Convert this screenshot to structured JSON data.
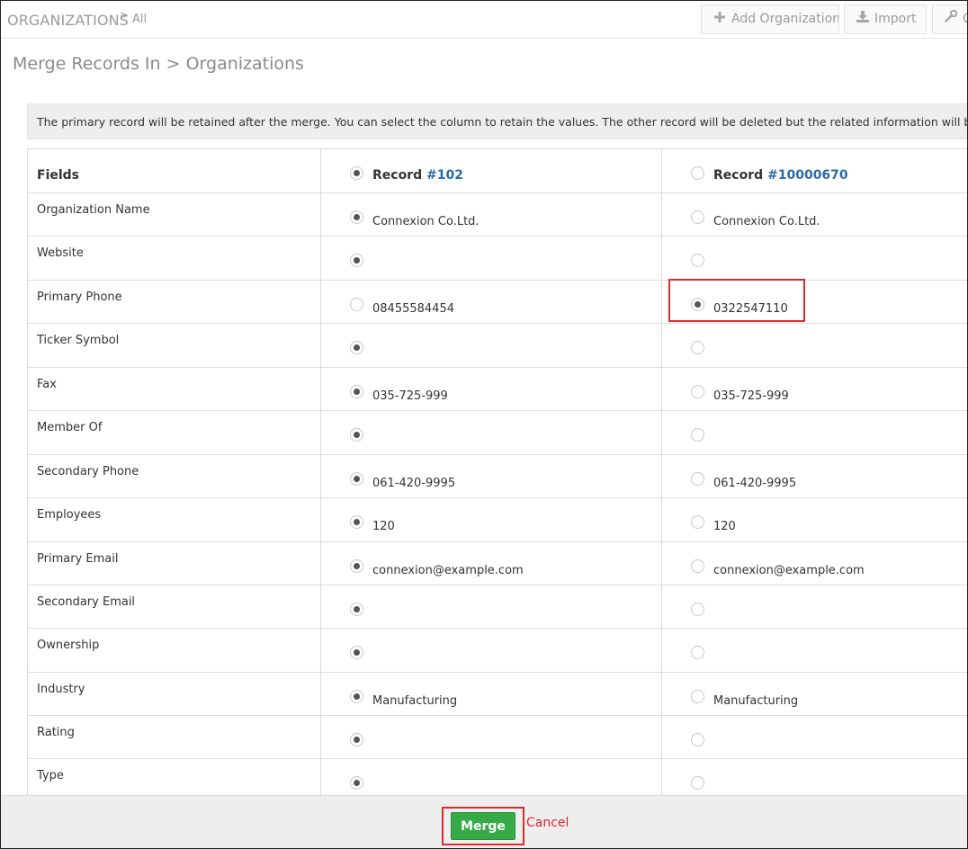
{
  "header": {
    "module": "ORGANIZATIONS",
    "breadcrumb_sep": ">",
    "breadcrumb_all": "All",
    "add_label": "Add Organization",
    "import_label": "Import",
    "more_label": "C"
  },
  "page_title": "Merge Records In > Organizations",
  "notice": "The primary record will be retained after the merge. You can select the column to retain the values. The other record will be deleted but the related information will be merged.",
  "table": {
    "fields_header": "Fields",
    "record_label": "Record",
    "record1_id": "#102",
    "record2_id": "#10000670",
    "record1_selected": true,
    "record2_selected": false,
    "rows": [
      {
        "field": "Organization Name",
        "v1": "Connexion Co.Ltd.",
        "v2": "Connexion Co.Ltd.",
        "selected": 1
      },
      {
        "field": "Website",
        "v1": "",
        "v2": "",
        "selected": 1
      },
      {
        "field": "Primary Phone",
        "v1": "08455584454",
        "v2": "0322547110",
        "selected": 2
      },
      {
        "field": "Ticker Symbol",
        "v1": "",
        "v2": "",
        "selected": 1
      },
      {
        "field": "Fax",
        "v1": "035-725-999",
        "v2": "035-725-999",
        "selected": 1
      },
      {
        "field": "Member Of",
        "v1": "",
        "v2": "",
        "selected": 1
      },
      {
        "field": "Secondary Phone",
        "v1": "061-420-9995",
        "v2": "061-420-9995",
        "selected": 1
      },
      {
        "field": "Employees",
        "v1": "120",
        "v2": "120",
        "selected": 1
      },
      {
        "field": "Primary Email",
        "v1": "connexion@example.com",
        "v2": "connexion@example.com",
        "selected": 1
      },
      {
        "field": "Secondary Email",
        "v1": "",
        "v2": "",
        "selected": 1
      },
      {
        "field": "Ownership",
        "v1": "",
        "v2": "",
        "selected": 1
      },
      {
        "field": "Industry",
        "v1": "Manufacturing",
        "v2": "Manufacturing",
        "selected": 1
      },
      {
        "field": "Rating",
        "v1": "",
        "v2": "",
        "selected": 1
      },
      {
        "field": "Type",
        "v1": "",
        "v2": "",
        "selected": 1
      }
    ]
  },
  "footer": {
    "merge_label": "Merge",
    "cancel_label": "Cancel"
  },
  "colors": {
    "merge_button": "#35aa47",
    "cancel_link": "#d62c2c",
    "record_id_link": "#2b6aa8",
    "highlight_box": "#d62c2c"
  },
  "icons": {
    "add": "plus-icon",
    "import": "download-icon",
    "more": "wrench-icon"
  }
}
